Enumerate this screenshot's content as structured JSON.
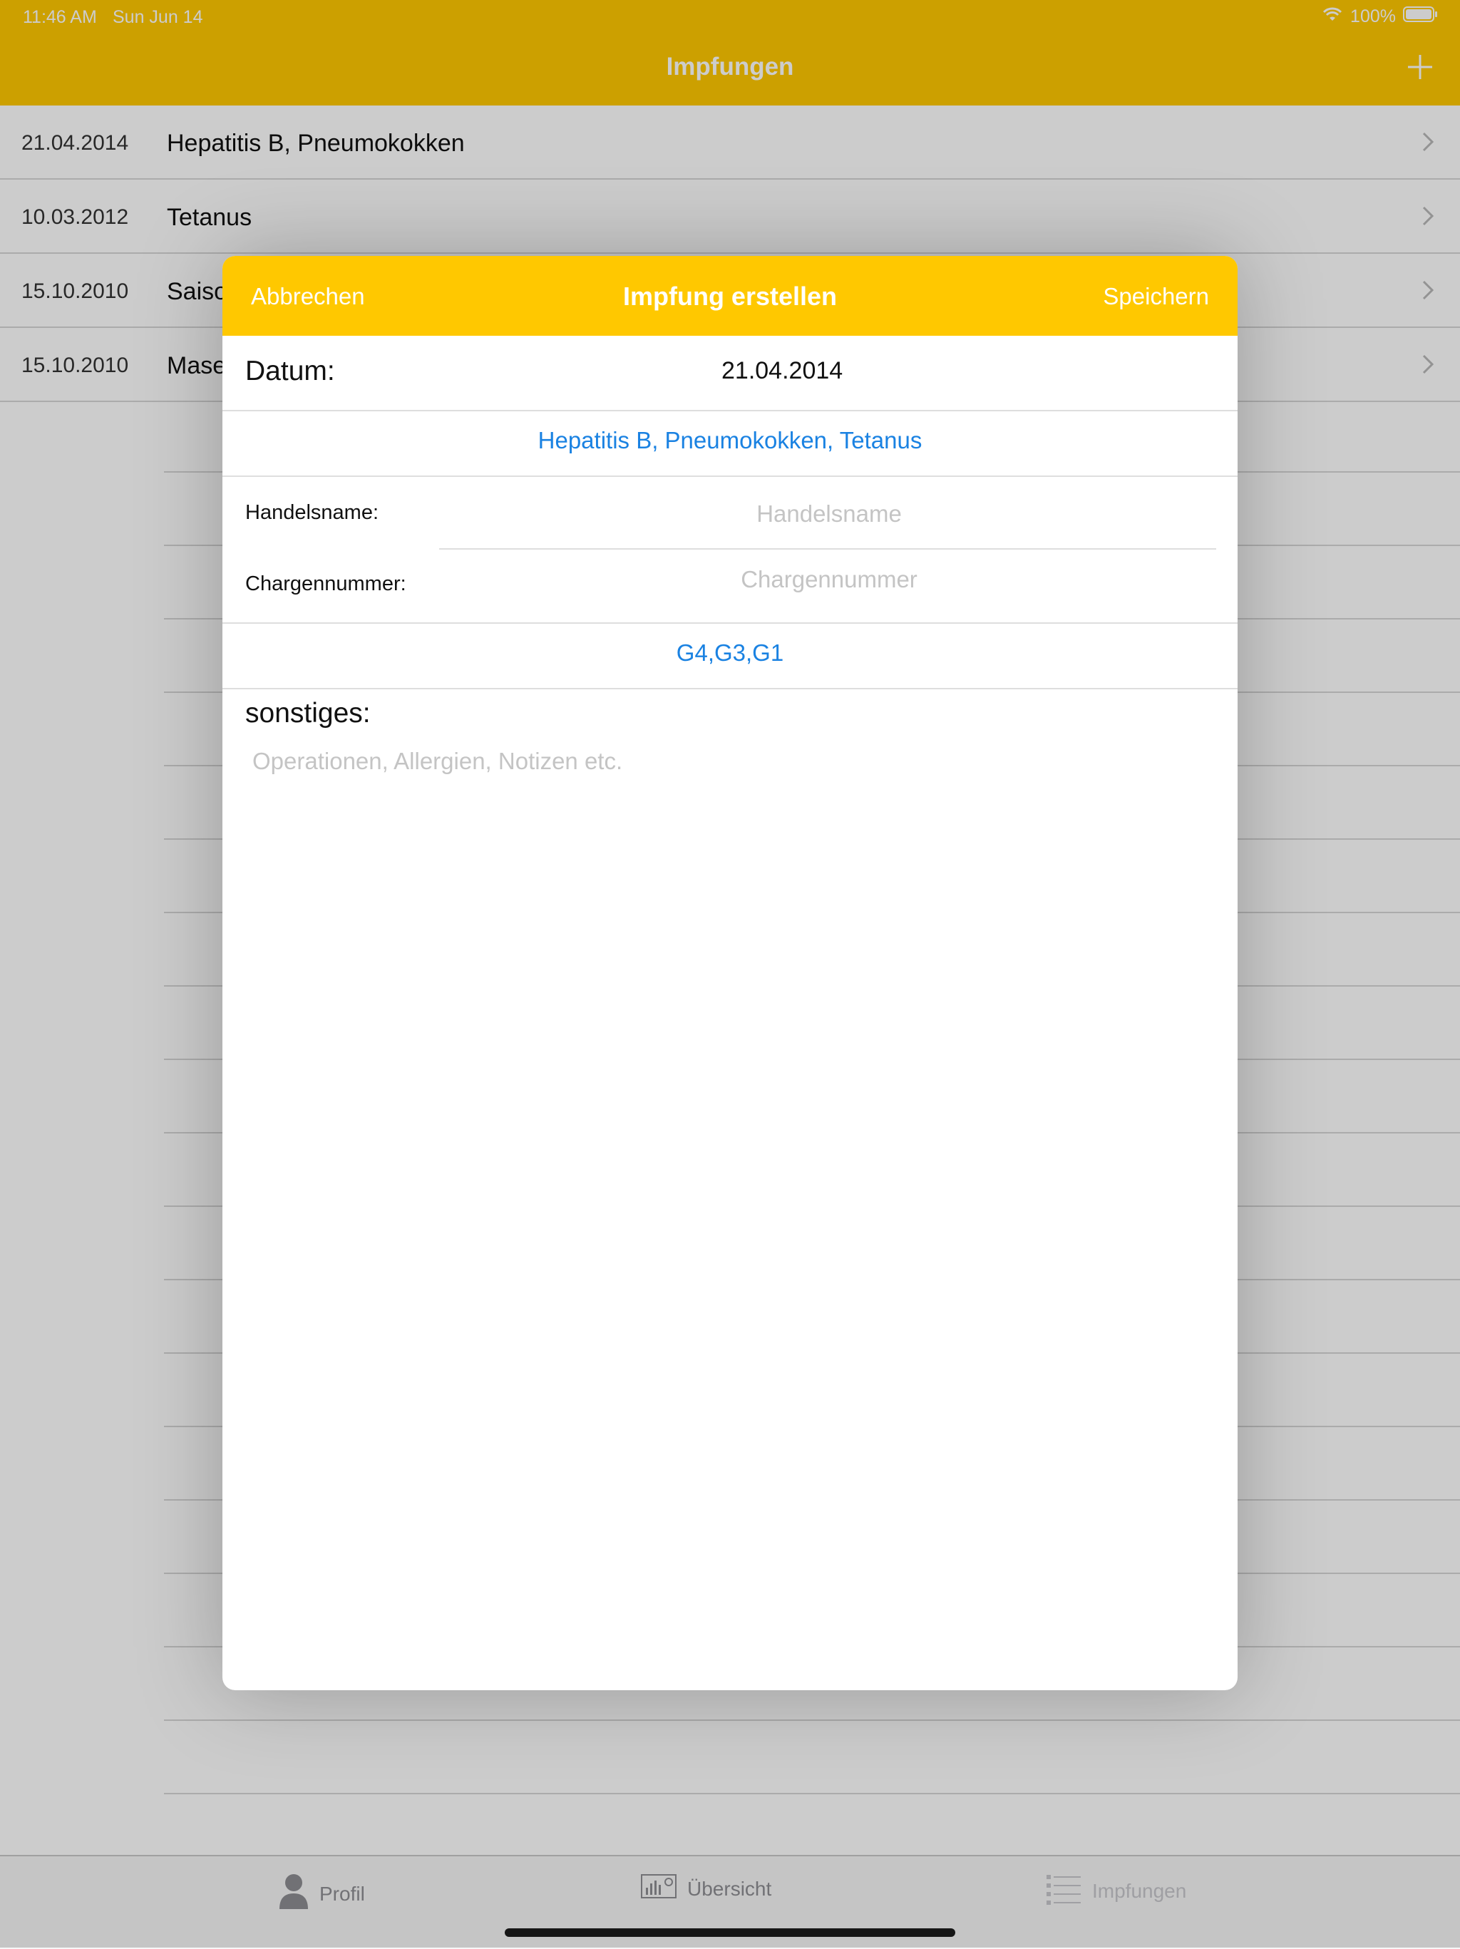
{
  "status_bar": {
    "time": "11:46 AM",
    "date": "Sun Jun 14",
    "battery": "100%"
  },
  "nav": {
    "title": "Impfungen"
  },
  "list": {
    "rows": [
      {
        "date": "21.04.2014",
        "title": "Hepatitis B, Pneumokokken"
      },
      {
        "date": "10.03.2012",
        "title": "Tetanus"
      },
      {
        "date": "15.10.2010",
        "title": "Saiso"
      },
      {
        "date": "15.10.2010",
        "title": "Mase"
      }
    ]
  },
  "tabbar": {
    "profile": "Profil",
    "overview": "Übersicht",
    "vaccinations": "Impfungen"
  },
  "modal": {
    "cancel": "Abbrechen",
    "title": "Impfung erstellen",
    "save": "Speichern",
    "date_label": "Datum:",
    "date_value": "21.04.2014",
    "diseases": "Hepatitis B, Pneumokokken, Tetanus",
    "trade_name_label": "Handelsname:",
    "trade_name_placeholder": "Handelsname",
    "batch_label": "Chargennummer:",
    "batch_placeholder": "Chargennummer",
    "groups": "G4,G3,G1",
    "other_label": "sonstiges:",
    "notes_placeholder": "Operationen, Allergien, Notizen etc."
  },
  "colors": {
    "accent": "#ffc800",
    "link": "#1a82e2"
  }
}
